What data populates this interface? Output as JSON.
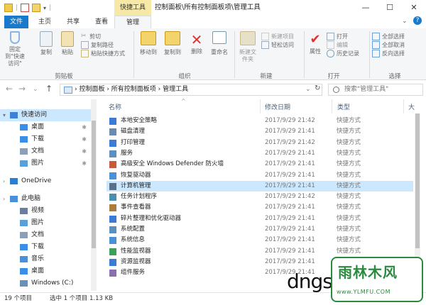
{
  "window": {
    "context_tab": "快捷工具",
    "title": "控制面板\\所有控制面板项\\管理工具",
    "min_glyph": "—",
    "max_glyph": "☐",
    "close_glyph": "✕"
  },
  "tabs": [
    "文件",
    "主页",
    "共享",
    "查看",
    "管理"
  ],
  "ribbon": {
    "clipboard": {
      "pin_quick": "固定到\"快速访问\"",
      "copy": "复制",
      "paste": "粘贴",
      "cut": "剪切",
      "copy_path": "复制路径",
      "paste_shortcut": "粘贴快捷方式",
      "group": "剪贴板"
    },
    "organize": {
      "move_to": "移动到",
      "copy_to": "复制到",
      "delete": "删除",
      "rename": "重命名",
      "group": "组织"
    },
    "new": {
      "new_folder": "新建文件夹",
      "new_item": "新建项目",
      "easy_access": "轻松访问",
      "group": "新建"
    },
    "open": {
      "properties": "属性",
      "open": "打开",
      "edit": "编辑",
      "history": "历史记录",
      "group": "打开"
    },
    "select": {
      "select_all": "全部选择",
      "select_none": "全部取消",
      "invert": "反向选择",
      "group": "选择"
    }
  },
  "address": {
    "path": "› 控制面板 › 所有控制面板项 › 管理工具",
    "search_placeholder": "搜索\"管理工具\"",
    "back": "←",
    "forward": "→",
    "up": "↑",
    "dropdown": "⌄",
    "refresh": "↻"
  },
  "nav": [
    {
      "label": "快速访问",
      "icon": "star-icon",
      "pinned": false,
      "indent": 0,
      "active": true
    },
    {
      "label": "桌面",
      "icon": "desktop-icon",
      "pinned": true,
      "indent": 1
    },
    {
      "label": "下载",
      "icon": "download-icon",
      "pinned": true,
      "indent": 1
    },
    {
      "label": "文档",
      "icon": "document-icon",
      "pinned": true,
      "indent": 1
    },
    {
      "label": "图片",
      "icon": "picture-icon",
      "pinned": true,
      "indent": 1
    },
    {
      "label": "OneDrive",
      "icon": "cloud-icon",
      "pinned": false,
      "indent": 0
    },
    {
      "label": "此电脑",
      "icon": "computer-icon",
      "pinned": false,
      "indent": 0
    },
    {
      "label": "视频",
      "icon": "video-icon",
      "pinned": false,
      "indent": 1
    },
    {
      "label": "图片",
      "icon": "picture-icon",
      "pinned": false,
      "indent": 1
    },
    {
      "label": "文档",
      "icon": "document-icon",
      "pinned": false,
      "indent": 1
    },
    {
      "label": "下载",
      "icon": "download-icon",
      "pinned": false,
      "indent": 1
    },
    {
      "label": "音乐",
      "icon": "music-icon",
      "pinned": false,
      "indent": 1
    },
    {
      "label": "桌面",
      "icon": "desktop-icon",
      "pinned": false,
      "indent": 1
    },
    {
      "label": "Windows (C:)",
      "icon": "drive-icon",
      "pinned": false,
      "indent": 1
    }
  ],
  "columns": {
    "name": "名称",
    "date": "修改日期",
    "type": "类型",
    "size": "大"
  },
  "files": [
    {
      "name": "本地安全策略",
      "date": "2017/9/29 21:42",
      "type": "快捷方式"
    },
    {
      "name": "磁盘清理",
      "date": "2017/9/29 21:41",
      "type": "快捷方式"
    },
    {
      "name": "打印管理",
      "date": "2017/9/29 21:42",
      "type": "快捷方式"
    },
    {
      "name": "服务",
      "date": "2017/9/29 21:41",
      "type": "快捷方式"
    },
    {
      "name": "高级安全 Windows Defender 防火墙",
      "date": "2017/9/29 21:41",
      "type": "快捷方式"
    },
    {
      "name": "恢复驱动器",
      "date": "2017/9/29 21:41",
      "type": "快捷方式"
    },
    {
      "name": "计算机管理",
      "date": "2017/9/29 21:41",
      "type": "快捷方式",
      "selected": true
    },
    {
      "name": "任务计划程序",
      "date": "2017/9/29 21:42",
      "type": "快捷方式"
    },
    {
      "name": "事件查看器",
      "date": "2017/9/29 21:41",
      "type": "快捷方式"
    },
    {
      "name": "碎片整理和优化驱动器",
      "date": "2017/9/29 21:41",
      "type": "快捷方式"
    },
    {
      "name": "系统配置",
      "date": "2017/9/29 21:41",
      "type": "快捷方式"
    },
    {
      "name": "系统信息",
      "date": "2017/9/29 21:41",
      "type": "快捷方式"
    },
    {
      "name": "性能监视器",
      "date": "2017/9/29 21:41",
      "type": "快捷方式"
    },
    {
      "name": "资源监视器",
      "date": "2017/9/29 21:41",
      "type": "快捷方式"
    },
    {
      "name": "组件服务",
      "date": "2017/9/29 21:41",
      "type": "快捷方式"
    }
  ],
  "status": {
    "count": "19 个项目",
    "selected": "选中 1 个项目 1.13 KB"
  },
  "watermark": {
    "text": "dngsw",
    "brand": "雨林木风",
    "url": "www.YLMFU.COM"
  },
  "colors": {
    "accent": "#1979ca",
    "selection": "#cce8ff",
    "context_tab": "#f6e8a6",
    "watermark": "#2b8a3e"
  }
}
